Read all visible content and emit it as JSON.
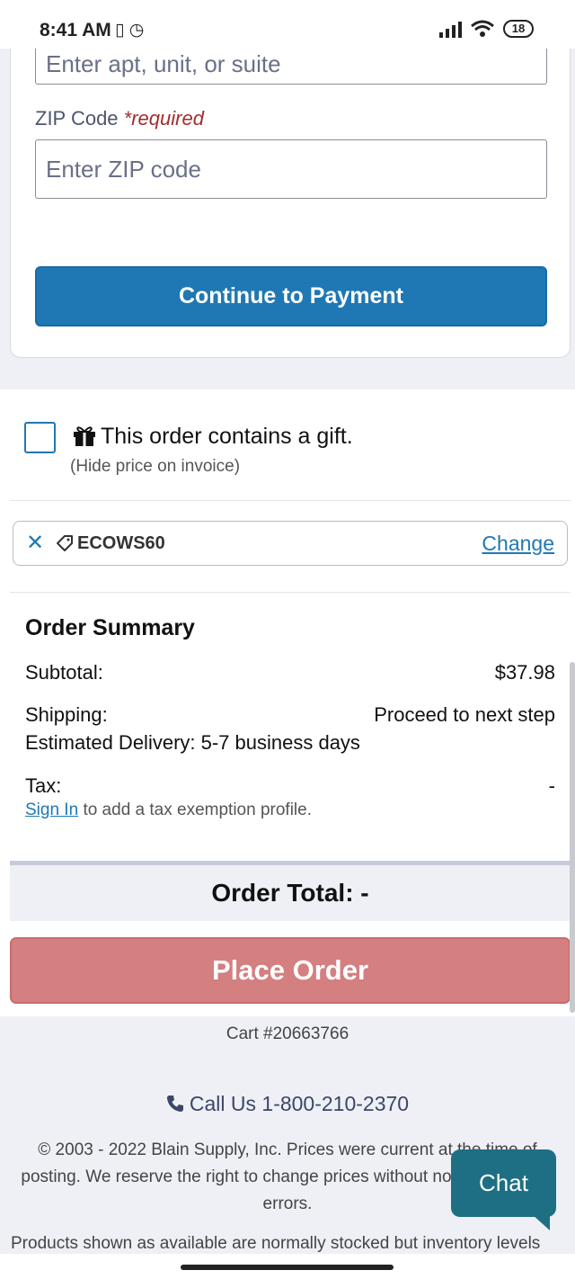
{
  "status_bar": {
    "time": "8:41 AM",
    "battery": "18"
  },
  "address_form": {
    "apt_placeholder": "Enter apt, unit, or suite",
    "zip_label": "ZIP Code",
    "zip_required": "*required",
    "zip_placeholder": "Enter ZIP code",
    "continue_label": "Continue to Payment"
  },
  "gift": {
    "label": "This order contains a gift.",
    "sublabel": "(Hide price on invoice)",
    "checked": false
  },
  "promo": {
    "code": "ECOWS60",
    "change_label": "Change"
  },
  "order_summary": {
    "title": "Order Summary",
    "subtotal_label": "Subtotal:",
    "subtotal_value": "$37.98",
    "shipping_label": "Shipping:",
    "shipping_value": "Proceed to next step",
    "delivery_text": "Estimated Delivery: 5-7 business days",
    "tax_label": "Tax:",
    "tax_value": "-",
    "sign_in_link": "Sign In",
    "tax_note": "to add a tax exemption profile.",
    "order_total": "Order Total: -",
    "place_order_label": "Place Order"
  },
  "footer": {
    "cart_number": "Cart #20663766",
    "call_us": "Call Us 1-800-210-2370",
    "copyright": "© 2003 - 2022 Blain Supply, Inc. Prices were current at the time of posting. We reserve the right to change prices without notice to correct errors.",
    "products_note": "Products shown as available are normally stocked but inventory levels"
  },
  "chat": {
    "label": "Chat"
  },
  "colors": {
    "primary": "#1f78b4",
    "place_order": "#d47f80",
    "chat": "#1e6f84",
    "required": "#a32d2d"
  }
}
